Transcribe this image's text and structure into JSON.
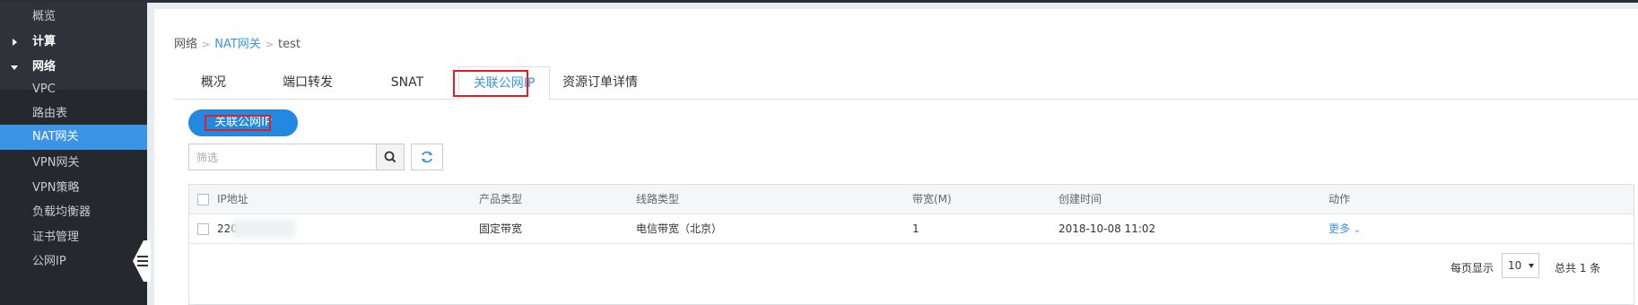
{
  "sidebar": {
    "overview": "概览",
    "compute": "计算",
    "network": "网络",
    "items": [
      "VPC",
      "路由表",
      "NAT网关",
      "VPN网关",
      "VPN策略",
      "负载均衡器",
      "证书管理",
      "公网IP"
    ]
  },
  "breadcrumb": {
    "root": "网络",
    "sep": ">",
    "parent": "NAT网关",
    "current": "test"
  },
  "tabs": [
    "概况",
    "端口转发",
    "SNAT",
    "关联公网IP",
    "资源订单详情"
  ],
  "actions": {
    "associate_button": "关联公网IP"
  },
  "search": {
    "placeholder": "筛选"
  },
  "table": {
    "headers": [
      "IP地址",
      "产品类型",
      "线路类型",
      "带宽(M)",
      "创建时间",
      "动作"
    ],
    "rows": [
      {
        "ip": "220",
        "product_type": "固定带宽",
        "line_type": "电信带宽（北京）",
        "bandwidth": "1",
        "created": "2018-10-08 11:02",
        "action": "更多"
      }
    ]
  },
  "pagination": {
    "per_page_label": "每页显示",
    "per_page_value": "10",
    "total": "总共 1 条"
  },
  "colors": {
    "accent": "#3a95e6",
    "sidebar_bg": "#2f3238",
    "highlight_box": "#e02020"
  }
}
